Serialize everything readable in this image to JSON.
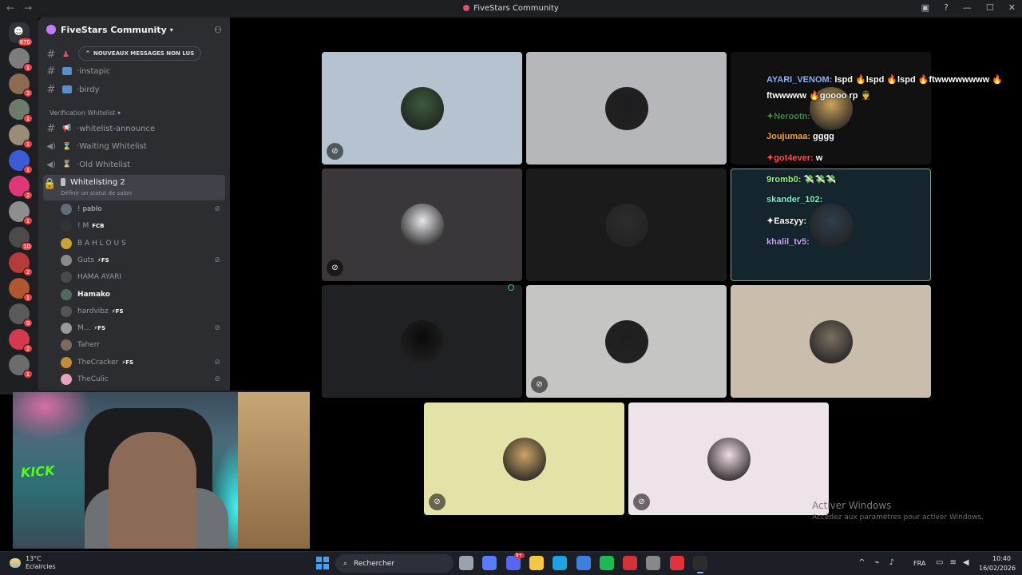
{
  "window": {
    "title": "FiveStars Community",
    "back_icon": "arrow-left-icon",
    "forward_icon": "arrow-right-icon"
  },
  "server_rail": {
    "home_badge": "870",
    "servers": [
      {
        "color": "#7c7c7c",
        "badge": "1"
      },
      {
        "color": "#8d6b53",
        "badge": "3"
      },
      {
        "color": "#6e7a6a",
        "badge": "1"
      },
      {
        "color": "#9b8c7a",
        "badge": "1"
      },
      {
        "color": "#3c5bd6",
        "badge": "1"
      },
      {
        "color": "#e0367a",
        "badge": "2"
      },
      {
        "color": "#8e8e8e",
        "badge": "1"
      },
      {
        "color": "#4b4b4b",
        "badge": "10"
      },
      {
        "color": "#b73a3a",
        "badge": "2"
      },
      {
        "color": "#b0572f",
        "badge": "1"
      },
      {
        "color": "#5a5a5a",
        "badge": "9"
      },
      {
        "color": "#d23b4e",
        "badge": "2"
      },
      {
        "color": "#6c6c6c",
        "badge": "1"
      }
    ]
  },
  "guild": {
    "name": "FiveStars Community",
    "new_messages_pill": "NOUVEAUX MESSAGES NON LUS",
    "channels_top": [
      {
        "name": "instapic",
        "kind": "text"
      },
      {
        "name": "birdy",
        "kind": "text"
      }
    ],
    "category": "Verification Whitelist",
    "channels_verif": [
      {
        "name": "whitelist-announce",
        "kind": "text"
      },
      {
        "name": "Waiting Whitelist",
        "kind": "voice"
      },
      {
        "name": "Old Whitelist",
        "kind": "voice"
      }
    ],
    "active_channel": {
      "name": "Whitelisting 2",
      "status_hint": "Définir un statut de salon"
    },
    "members": [
      {
        "name": "! 𝐩𝐚𝐛𝐥𝐨",
        "tag": "",
        "muted": true,
        "color": "#5d6b7a"
      },
      {
        "name": "! M",
        "tag": "FCB",
        "muted": false,
        "color": "#333"
      },
      {
        "name": "B A H L O U S",
        "tag": "",
        "muted": false,
        "color": "#c9a23a"
      },
      {
        "name": "Guts",
        "tag": "⚡FS",
        "muted": true,
        "color": "#8a8a8a"
      },
      {
        "name": "HAMA AYARI",
        "tag": "",
        "muted": false,
        "color": "#4a4a4a"
      },
      {
        "name": "Hamako",
        "tag": "",
        "muted": false,
        "color": "#4f6b5f",
        "bold": true
      },
      {
        "name": "hardvibz",
        "tag": "⚡FS",
        "muted": false,
        "color": "#555"
      },
      {
        "name": "M...",
        "tag": "⚡FS",
        "muted": true,
        "color": "#9a9a9a"
      },
      {
        "name": "Taherr",
        "tag": "",
        "muted": false,
        "color": "#7d6a5a"
      },
      {
        "name": "TheCracker",
        "tag": "⚡FS",
        "muted": true,
        "color": "#c58b3a"
      },
      {
        "name": "TheCulic",
        "tag": "",
        "muted": true,
        "color": "#e6a3b9"
      }
    ]
  },
  "tiles": [
    {
      "bg": "#b4c3cf",
      "avatar": "#3a5a3a",
      "muted": true
    },
    {
      "bg": "#b6b7ba",
      "avatar": "#1d1d1f",
      "muted": false
    },
    {
      "bg": "#111111",
      "avatar": "#caa35a",
      "muted": false
    },
    {
      "bg": "#3a3639",
      "avatar": "#e6e6ea",
      "muted": true
    },
    {
      "bg": "#1b1b1c",
      "avatar": "#2d2d2d",
      "muted": false
    },
    {
      "bg": "#15252e",
      "avatar": "#2e3f4c",
      "muted": false,
      "speaking": true
    },
    {
      "bg": "#1f2124",
      "avatar": "#0a0a0a",
      "muted": false
    },
    {
      "bg": "#c5c6c4",
      "avatar": "#1e1e1e",
      "muted": true
    },
    {
      "bg": "#c9beac",
      "avatar": "#7a6f61",
      "muted": false
    },
    {
      "bg": "#e3e3a8",
      "avatar": "#caa566",
      "muted": true
    },
    {
      "bg": "#efe3ea",
      "avatar": "#f2d9e5",
      "muted": true
    }
  ],
  "chat": [
    {
      "user": "AYARI_VENOM:",
      "color": "#8ab4f8",
      "text": "lspd 🔥lspd 🔥lspd 🔥ftwwwwwwww 🔥"
    },
    {
      "user": "",
      "color": "#ffffff",
      "text": "ftwwwww 🔥goooo rp 🧑‍✈️"
    },
    {
      "user": "✦Nerootn:",
      "color": "#3c8c3c",
      "text": ""
    },
    {
      "user": "Joujumaa:",
      "color": "#f5a623",
      "text": "gggg"
    },
    {
      "user": "✦got4ever:",
      "color": "#ff4a4a",
      "text": "w"
    },
    {
      "user": "9romb0:",
      "color": "#9bf07f",
      "text": "💸💸💸"
    },
    {
      "user": "skander_102:",
      "color": "#7ff0c8",
      "text": ""
    },
    {
      "user": "✦Easzyy:",
      "color": "#ffffff",
      "text": ""
    },
    {
      "user": "khalil_tv5:",
      "color": "#c9a6ff",
      "text": ""
    }
  ],
  "webcam": {
    "brand_text": "KICK"
  },
  "watermark": {
    "line1": "Activer Windows",
    "line2": "Accédez aux paramètres pour activer Windows."
  },
  "taskbar": {
    "weather_temp": "13°C",
    "weather_desc": "Eclaircies",
    "search_placeholder": "Rechercher",
    "apps": [
      {
        "name": "task-view-icon",
        "color": "#9aa3ad"
      },
      {
        "name": "copilot-icon",
        "color": "#5b7cff"
      },
      {
        "name": "discord-icon",
        "color": "#5865f2",
        "badge": "9+"
      },
      {
        "name": "file-explorer-icon",
        "color": "#f2c744"
      },
      {
        "name": "edge-icon",
        "color": "#1fa2e0"
      },
      {
        "name": "store-icon",
        "color": "#3d7fe0"
      },
      {
        "name": "spotify-icon",
        "color": "#1db954"
      },
      {
        "name": "app-red-icon",
        "color": "#d13438"
      },
      {
        "name": "chrome-icon",
        "color": "#888"
      },
      {
        "name": "app-b-icon",
        "color": "#e0343a"
      },
      {
        "name": "obs-icon",
        "color": "#2d2d2d",
        "active": true
      }
    ],
    "language": "FRA",
    "time": "10:40",
    "date": "16/02/2026"
  }
}
